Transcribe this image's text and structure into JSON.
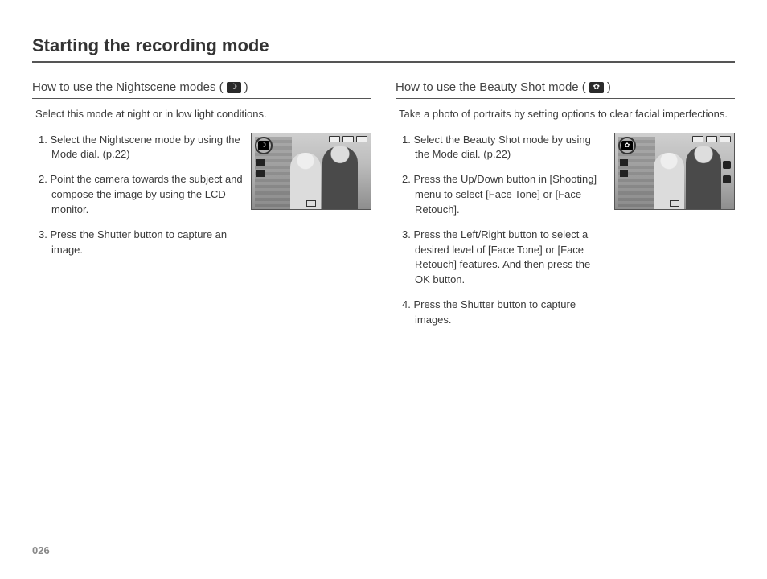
{
  "page": {
    "title": "Starting the recording mode",
    "number": "026"
  },
  "left": {
    "heading_pre": "How to use the Nightscene modes (",
    "heading_post": ")",
    "icon_glyph": "☽",
    "intro": "Select this mode at night or in low light conditions.",
    "steps": [
      "1. Select the Nightscene mode by using the Mode dial. (p.22)",
      "2. Point the camera towards the subject and compose the image by using the LCD monitor.",
      "3. Press the Shutter button to capture an image."
    ]
  },
  "right": {
    "heading_pre": "How to use the Beauty Shot mode (",
    "heading_post": ")",
    "icon_glyph": "✿",
    "intro": "Take a photo of portraits by setting options to clear facial imperfections.",
    "steps": [
      "1. Select the Beauty Shot mode by using the Mode dial. (p.22)",
      "2. Press the Up/Down button in [Shooting] menu to select [Face Tone] or [Face Retouch].",
      "3. Press the Left/Right button to select a desired level of [Face Tone] or [Face Retouch] features. And then press the OK button.",
      "4. Press the Shutter button to capture images."
    ]
  }
}
